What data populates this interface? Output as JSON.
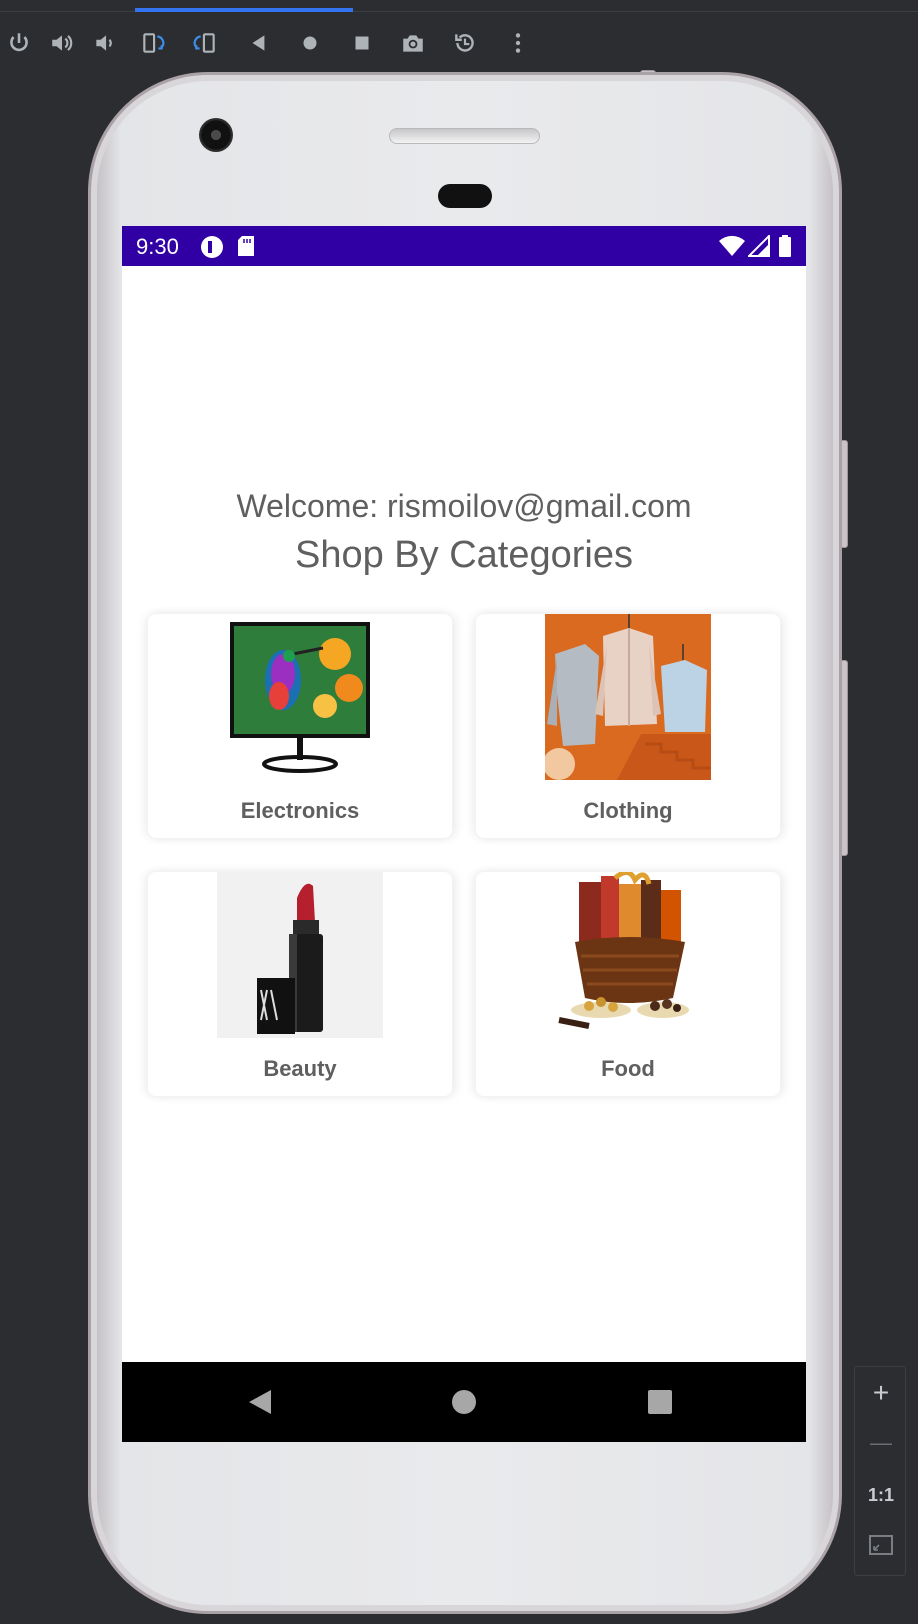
{
  "emulator": {
    "toolbar_icons": [
      "power-icon",
      "volume-up-icon",
      "volume-down-icon",
      "rotate-left-icon",
      "rotate-right-icon",
      "back-icon",
      "home-icon",
      "overview-icon",
      "screenshot-icon",
      "snapshot-icon",
      "more-icon"
    ],
    "zoom": {
      "zoom_in": "+",
      "zoom_out": "—",
      "actual_size": "1:1"
    },
    "colors": {
      "accent": "#3574f0",
      "status_bar": "#3000a5"
    }
  },
  "status_bar": {
    "time": "9:30"
  },
  "screen": {
    "welcome": "Welcome: rismoilov@gmail.com",
    "heading": "Shop By Categories",
    "categories": [
      {
        "label": "Electronics",
        "image": "monitor-hummingbird-image"
      },
      {
        "label": "Clothing",
        "image": "sweaters-image"
      },
      {
        "label": "Beauty",
        "image": "lipstick-image"
      },
      {
        "label": "Food",
        "image": "gift-basket-image"
      }
    ]
  },
  "nav_bar": {
    "icons": [
      "back-triangle-icon",
      "home-circle-icon",
      "recents-square-icon"
    ]
  }
}
